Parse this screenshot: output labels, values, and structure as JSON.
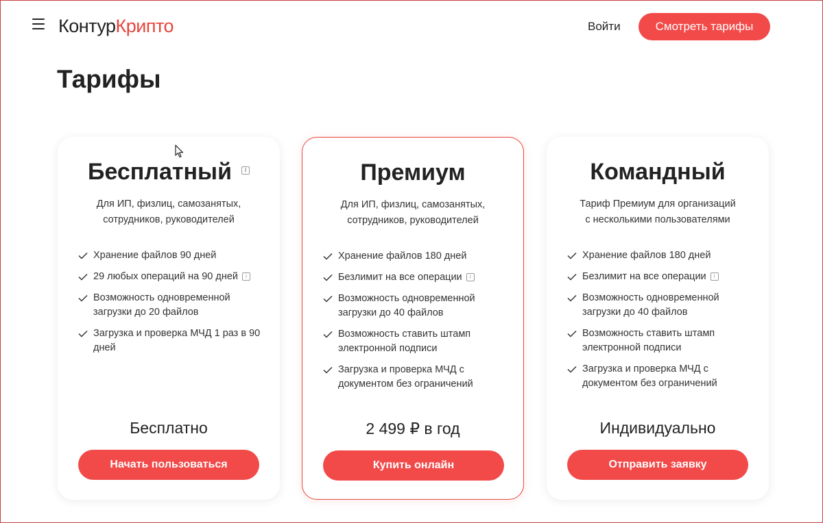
{
  "header": {
    "logo_part1": "Контур",
    "logo_part2": "Крипто",
    "login_label": "Войти",
    "cta_label": "Смотреть тарифы"
  },
  "page": {
    "title": "Тарифы"
  },
  "plans": [
    {
      "name": "Бесплатный",
      "description_line1": "Для ИП, физлиц, самозанятых,",
      "description_line2": "сотрудников, руководителей",
      "features": [
        "Хранение файлов 90 дней",
        "29 любых операций на 90 дней",
        "Возможность одновременной загрузки до 20 файлов",
        "Загрузка и проверка МЧД 1 раз в 90 дней"
      ],
      "price": "Бесплатно",
      "button_label": "Начать пользоваться"
    },
    {
      "name": "Премиум",
      "description_line1": "Для ИП, физлиц, самозанятых,",
      "description_line2": "сотрудников, руководителей",
      "features": [
        "Хранение файлов 180 дней",
        "Безлимит на все операции",
        "Возможность одновременной загрузки до 40 файлов",
        "Возможность ставить штамп электронной подписи",
        "Загрузка и проверка МЧД с документом без ограничений"
      ],
      "price": "2 499 ₽ в год",
      "button_label": "Купить онлайн"
    },
    {
      "name": "Командный",
      "description_line1": "Тариф Премиум для организаций",
      "description_line2": "с несколькими пользователями",
      "features": [
        "Хранение файлов 180 дней",
        "Безлимит на все операции",
        "Возможность одновременной загрузки до 40 файлов",
        "Возможность ставить штамп электронной подписи",
        "Загрузка и проверка МЧД с документом без ограничений"
      ],
      "price": "Индивидуально",
      "button_label": "Отправить заявку"
    }
  ],
  "icons": {
    "menu": "hamburger-menu-icon",
    "check": "checkmark-icon",
    "info": "info-icon",
    "cursor": "mouse-cursor-icon"
  },
  "colors": {
    "accent": "#f24949",
    "text": "#222222",
    "card_border_highlight": "#e8453c"
  }
}
